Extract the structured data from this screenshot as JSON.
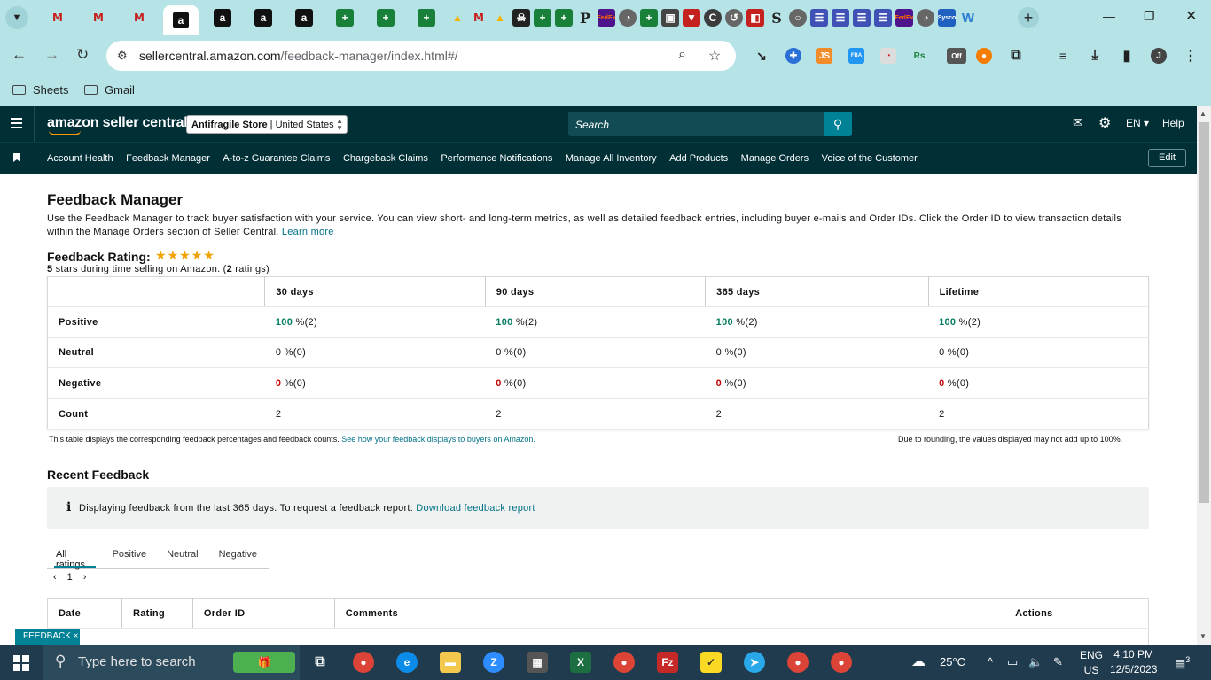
{
  "browser": {
    "url_host": "sellercentral.amazon.com",
    "url_path": "/feedback-manager/index.html#/",
    "bookmarks": [
      "Sheets",
      "Gmail"
    ],
    "tab_favicons": [
      "gmail",
      "gmail",
      "gmail",
      "amazon-active",
      "amazon",
      "amazon",
      "amazon",
      "sheets",
      "sheets",
      "sheets",
      "drive",
      "gmail",
      "drive",
      "pirate",
      "sheets",
      "sheets",
      "p",
      "fedex",
      "wish",
      "sheets",
      "disk",
      "funnel",
      "c",
      "history",
      "app",
      "s",
      "chrome",
      "doc",
      "doc",
      "doc",
      "doc",
      "fedex",
      "wish",
      "sysco",
      "word"
    ],
    "tab_glyphs": {
      "amazon": "a",
      "sheets": "+",
      "gmail": "M",
      "drive": "▲",
      "p": "P",
      "word": "W"
    }
  },
  "header": {
    "logo": "amazon seller central",
    "store_name": "Antifragile Store",
    "store_region": "United States",
    "search_placeholder": "Search",
    "language": "EN",
    "help": "Help"
  },
  "nav": {
    "links": [
      "Account Health",
      "Feedback Manager",
      "A-to-z Guarantee Claims",
      "Chargeback Claims",
      "Performance Notifications",
      "Manage All Inventory",
      "Add Products",
      "Manage Orders",
      "Voice of the Customer"
    ],
    "edit": "Edit"
  },
  "page": {
    "title": "Feedback Manager",
    "intro": "Use the Feedback Manager to track buyer satisfaction with your service. You can view short- and long-term metrics, as well as detailed feedback entries, including buyer e-mails and Order IDs. Click the Order ID to view transaction details within the Manage Orders section of Seller Central.",
    "learn_more": "Learn more",
    "rating_title": "Feedback Rating:",
    "rating_stars": 5,
    "rating_text_pre": "5",
    "rating_text_mid": " stars during time selling on Amazon. (",
    "rating_count": "2",
    "rating_text_post": " ratings)"
  },
  "metrics": {
    "columns": [
      "30 days",
      "90 days",
      "365 days",
      "Lifetime"
    ],
    "rows": [
      {
        "label": "Positive",
        "cells": [
          {
            "num": "100",
            "rest": " %(2)"
          },
          {
            "num": "100",
            "rest": " %(2)"
          },
          {
            "num": "100",
            "rest": " %(2)"
          },
          {
            "num": "100",
            "rest": " %(2)"
          }
        ]
      },
      {
        "label": "Neutral",
        "cells": [
          {
            "num": "0",
            "rest": " %(0)"
          },
          {
            "num": "0",
            "rest": " %(0)"
          },
          {
            "num": "0",
            "rest": " %(0)"
          },
          {
            "num": "0",
            "rest": " %(0)"
          }
        ]
      },
      {
        "label": "Negative",
        "cells": [
          {
            "num": "0",
            "rest": " %(0)"
          },
          {
            "num": "0",
            "rest": " %(0)"
          },
          {
            "num": "0",
            "rest": " %(0)"
          },
          {
            "num": "0",
            "rest": " %(0)"
          }
        ]
      },
      {
        "label": "Count",
        "cells": [
          {
            "num": "",
            "rest": "2"
          },
          {
            "num": "",
            "rest": "2"
          },
          {
            "num": "",
            "rest": "2"
          },
          {
            "num": "",
            "rest": "2"
          }
        ]
      }
    ],
    "note_left": "This table displays the corresponding feedback percentages and feedback counts.",
    "note_left_link": "See how your feedback displays to buyers on Amazon.",
    "note_right": "Due to rounding, the values displayed may not add up to 100%."
  },
  "recent": {
    "title": "Recent Feedback",
    "info": "Displaying feedback from the last 365 days. To request a feedback report:",
    "info_link": "Download feedback report",
    "tabs": [
      "All ratings",
      "Positive",
      "Neutral",
      "Negative"
    ],
    "page": "1",
    "columns": [
      "Date",
      "Rating",
      "Order ID",
      "Comments",
      "Actions"
    ],
    "feedback_tag": "FEEDBACK ×"
  },
  "taskbar": {
    "search_placeholder": "Type here to search",
    "temperature": "25°C",
    "lang1": "ENG",
    "lang2": "US",
    "time": "4:10 PM",
    "date": "12/5/2023",
    "notifications": "3"
  }
}
